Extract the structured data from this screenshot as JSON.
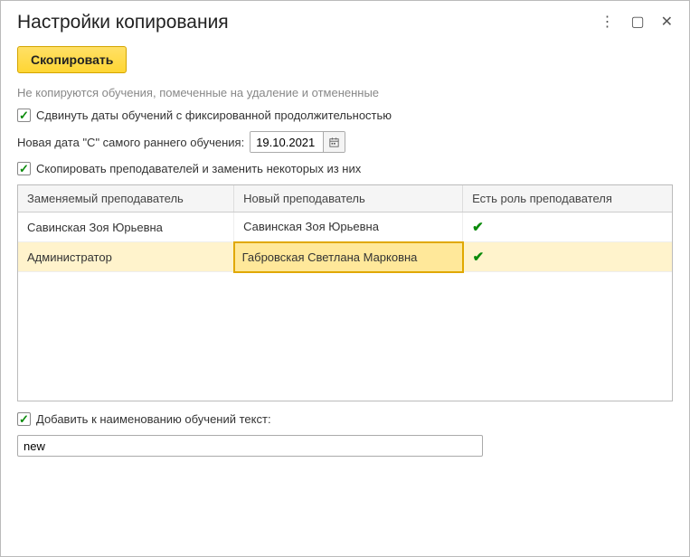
{
  "window": {
    "title": "Настройки копирования"
  },
  "actions": {
    "copy_label": "Скопировать"
  },
  "info": "Не копируются обучения, помеченные на удаление и отмененные",
  "shift_dates": {
    "label": "Сдвинуть даты обучений с фиксированной продолжительностью",
    "checked": true
  },
  "new_date": {
    "label": "Новая дата \"С\" самого раннего обучения:",
    "value": "19.10.2021"
  },
  "copy_teachers": {
    "label": "Скопировать преподавателей и заменить некоторых из них",
    "checked": true
  },
  "table": {
    "headers": {
      "replaced": "Заменяемый преподаватель",
      "new": "Новый преподаватель",
      "has_role": "Есть роль преподавателя"
    },
    "rows": [
      {
        "replaced": "Савинская Зоя Юрьевна",
        "new": "Савинская Зоя Юрьевна",
        "has_role": true,
        "selected": false,
        "active_cell": null
      },
      {
        "replaced": "Администратор",
        "new": "Габровская Светлана Марковна",
        "has_role": true,
        "selected": true,
        "active_cell": "new"
      }
    ]
  },
  "append_name": {
    "label": "Добавить к наименованию обучений текст:",
    "checked": true,
    "value": "new"
  }
}
